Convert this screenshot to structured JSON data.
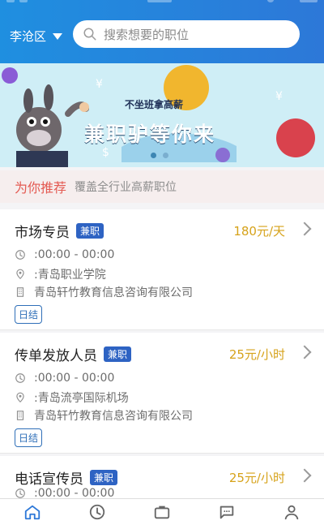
{
  "header": {
    "city": "李沧区",
    "search_placeholder": "搜索想要的职位",
    "colors": {
      "primary": "#2d78d8"
    }
  },
  "banner": {
    "slogan_small": "不坐班拿高薪",
    "slogan_large": "兼职驴等你来",
    "carousel_index": 1,
    "carousel_count": 2
  },
  "recommend": {
    "title": "为你推荐",
    "subtitle": "覆盖全行业高薪职位"
  },
  "jobs": [
    {
      "title": "市场专员",
      "type": "兼职",
      "salary": "180元/天",
      "time": ":00:00 - 00:00",
      "location": ":青岛职业学院",
      "company": "青岛轩竹教育信息咨询有限公司",
      "settle": "日结"
    },
    {
      "title": "传单发放人员",
      "type": "兼职",
      "salary": "25元/小时",
      "time": ":00:00 - 00:00",
      "location": ":青岛流亭国际机场",
      "company": "青岛轩竹教育信息咨询有限公司",
      "settle": "日结"
    },
    {
      "title": "电话宣传员",
      "type": "兼职",
      "salary": "25元/小时",
      "time": ":00:00 - 00:00"
    }
  ],
  "tabbar": {
    "active_index": 0,
    "icons": [
      "home-icon",
      "clock-icon",
      "briefcase-icon",
      "message-icon",
      "user-icon"
    ]
  }
}
